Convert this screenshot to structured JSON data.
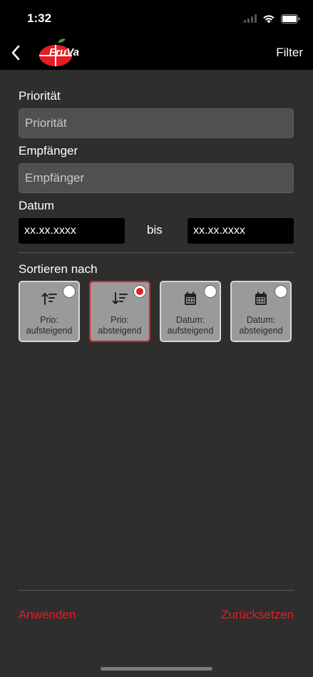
{
  "status_bar": {
    "time": "1:32"
  },
  "nav": {
    "title": "Filter",
    "logo_text": "FruVa"
  },
  "fields": {
    "priority": {
      "label": "Priorität",
      "placeholder": "Priorität"
    },
    "recipient": {
      "label": "Empfänger",
      "placeholder": "Empfänger"
    },
    "date": {
      "label": "Datum",
      "from": "xx.xx.xxxx",
      "separator": "bis",
      "to": "xx.xx.xxxx"
    }
  },
  "sort": {
    "label": "Sortieren nach",
    "options": [
      {
        "line1": "Prio:",
        "line2": "aufsteigend",
        "icon": "sort-ascending-icon",
        "selected": false
      },
      {
        "line1": "Prio:",
        "line2": "absteigend",
        "icon": "sort-descending-icon",
        "selected": true
      },
      {
        "line1": "Datum:",
        "line2": "aufsteigend",
        "icon": "calendar-icon",
        "selected": false
      },
      {
        "line1": "Datum:",
        "line2": "absteigend",
        "icon": "calendar-icon",
        "selected": false
      }
    ]
  },
  "actions": {
    "apply": "Anwenden",
    "reset": "Zurücksetzen"
  },
  "colors": {
    "accent": "#e31e24",
    "background": "#2e2e2e",
    "bar": "#000000"
  }
}
